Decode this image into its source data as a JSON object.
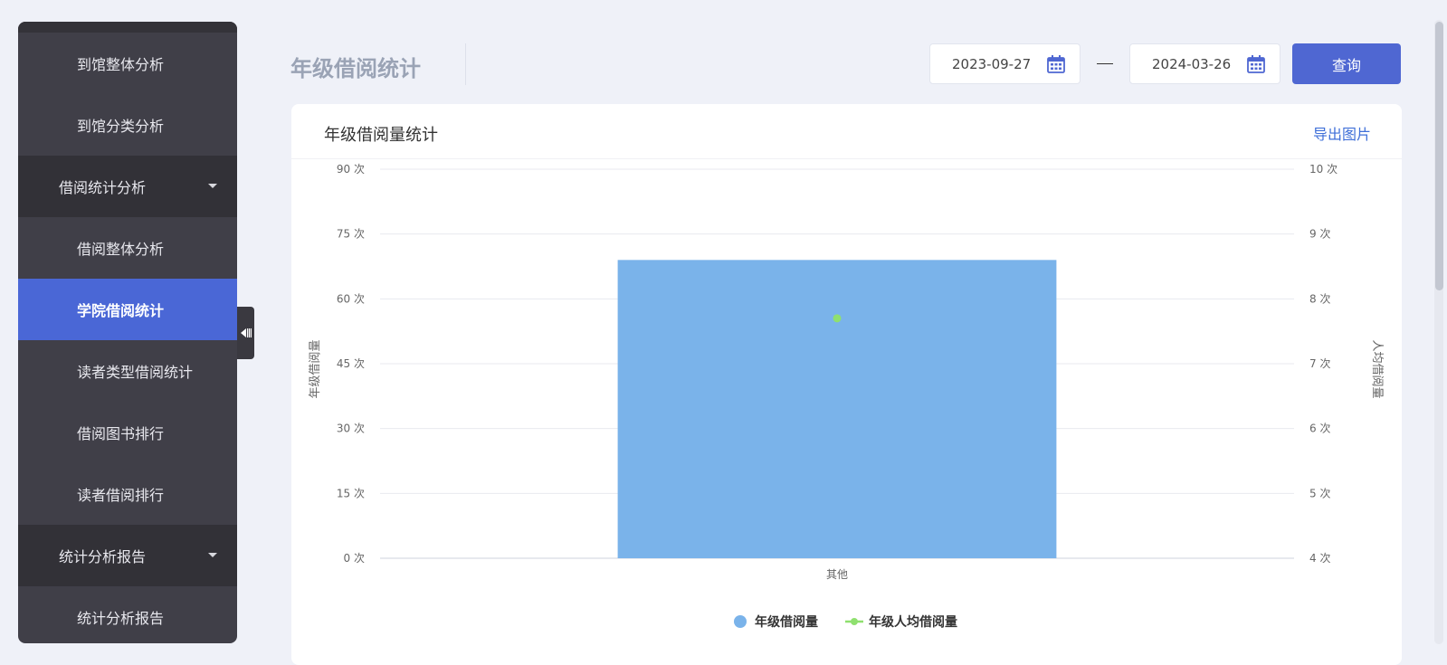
{
  "sidebar": {
    "items": [
      {
        "label": "到馆整体分析"
      },
      {
        "label": "到馆分类分析"
      },
      {
        "label": "借阅统计分析"
      },
      {
        "label": "借阅整体分析"
      },
      {
        "label": "学院借阅统计"
      },
      {
        "label": "读者类型借阅统计"
      },
      {
        "label": "借阅图书排行"
      },
      {
        "label": "读者借阅排行"
      },
      {
        "label": "统计分析报告"
      },
      {
        "label": "统计分析报告"
      }
    ],
    "active_label": "学院借阅统计"
  },
  "header": {
    "title": "年级借阅统计",
    "start_date": "2023-09-27",
    "end_date": "2024-03-26",
    "query_label": "查询",
    "icons": {
      "date": "calendar-icon",
      "collapse": "collapse-arrow-icon"
    }
  },
  "card": {
    "title": "年级借阅量统计",
    "export_label": "导出图片"
  },
  "colors": {
    "accent": "#4f67d2",
    "bar": "#7ab3ea",
    "line": "#8fe06f",
    "sidebar_bg": "#403f48",
    "active_bg": "#4a67d6"
  },
  "chart_data": {
    "type": "bar",
    "categories": [
      "其他"
    ],
    "series": [
      {
        "name": "年级借阅量",
        "type": "bar",
        "axis": "left",
        "values": [
          69
        ]
      },
      {
        "name": "年级人均借阅量",
        "type": "line",
        "axis": "right",
        "values": [
          7.7
        ]
      }
    ],
    "ylabel": "年级借阅量",
    "ylabel_right": "人均借阅量",
    "ylim": [
      0,
      90
    ],
    "ylim_right": [
      4,
      10
    ],
    "y_ticks": [
      "0 次",
      "15 次",
      "30 次",
      "45 次",
      "60 次",
      "75 次",
      "90 次"
    ],
    "y_ticks_right": [
      "4 次",
      "5 次",
      "6 次",
      "7 次",
      "8 次",
      "9 次",
      "10 次"
    ],
    "grid": true,
    "legend": "bottom-center"
  }
}
